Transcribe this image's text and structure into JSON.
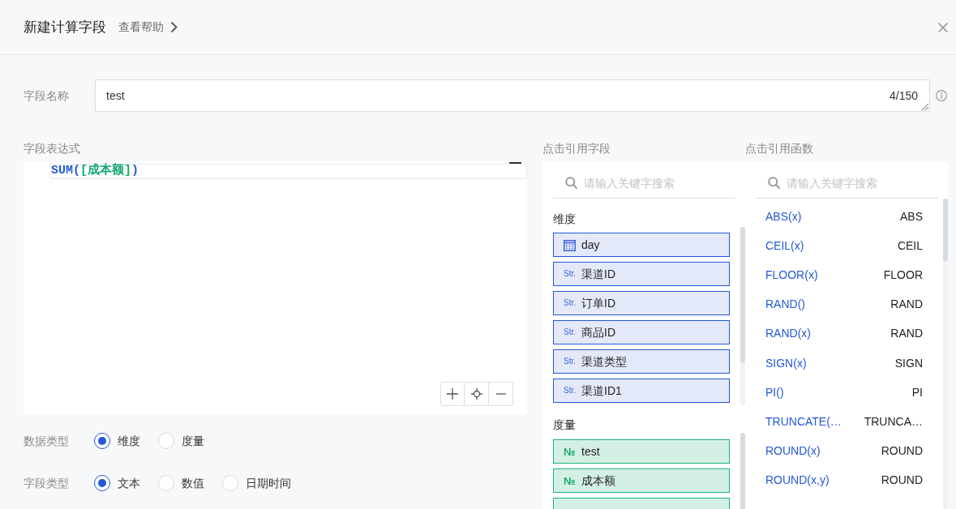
{
  "dialog": {
    "title": "新建计算字段",
    "help_link": "查看帮助"
  },
  "field_name": {
    "label": "字段名称",
    "value": "test",
    "counter": "4/150"
  },
  "expression": {
    "label": "字段表达式",
    "tokens": [
      {
        "text": "SUM(",
        "kind": "function"
      },
      {
        "text": "[成本额]",
        "kind": "field"
      },
      {
        "text": ")",
        "kind": "function"
      }
    ]
  },
  "data_type": {
    "label": "数据类型",
    "options": [
      {
        "label": "维度",
        "selected": true
      },
      {
        "label": "度量",
        "selected": false
      }
    ]
  },
  "field_type": {
    "label": "字段类型",
    "options": [
      {
        "label": "文本",
        "selected": true
      },
      {
        "label": "数值",
        "selected": false
      },
      {
        "label": "日期时间",
        "selected": false
      }
    ]
  },
  "fields_panel": {
    "title": "点击引用字段",
    "search": {
      "placeholder": "请输入关键字搜索"
    },
    "groups": [
      {
        "title": "维度",
        "kind": "dimension",
        "items": [
          {
            "name": "day",
            "kind": "date"
          },
          {
            "name": "渠道ID",
            "kind": "string",
            "type_label": "Str."
          },
          {
            "name": "订单ID",
            "kind": "string",
            "type_label": "Str."
          },
          {
            "name": "商品ID",
            "kind": "string",
            "type_label": "Str."
          },
          {
            "name": "渠道类型",
            "kind": "string",
            "type_label": "Str."
          },
          {
            "name": "渠道ID1",
            "kind": "string",
            "type_label": "Str."
          }
        ]
      },
      {
        "title": "度量",
        "kind": "measure",
        "items": [
          {
            "name": "test",
            "kind": "number",
            "type_label": "№"
          },
          {
            "name": "成本额",
            "kind": "number",
            "type_label": "№"
          },
          {
            "kind": "number"
          }
        ]
      }
    ]
  },
  "functions_panel": {
    "title": "点击引用函数",
    "search": {
      "placeholder": "请输入关键字搜索"
    },
    "items": [
      {
        "signature": "ABS(x)",
        "name": "ABS"
      },
      {
        "signature": "CEIL(x)",
        "name": "CEIL"
      },
      {
        "signature": "FLOOR(x)",
        "name": "FLOOR"
      },
      {
        "signature": "RAND()",
        "name": "RAND"
      },
      {
        "signature": "RAND(x)",
        "name": "RAND"
      },
      {
        "signature": "SIGN(x)",
        "name": "SIGN"
      },
      {
        "signature": "PI()",
        "name": "PI"
      },
      {
        "signature": "TRUNCATE(…",
        "name": "TRUNCA…"
      },
      {
        "signature": "ROUND(x)",
        "name": "ROUND"
      },
      {
        "signature": "ROUND(x,y)",
        "name": "ROUND"
      }
    ]
  }
}
